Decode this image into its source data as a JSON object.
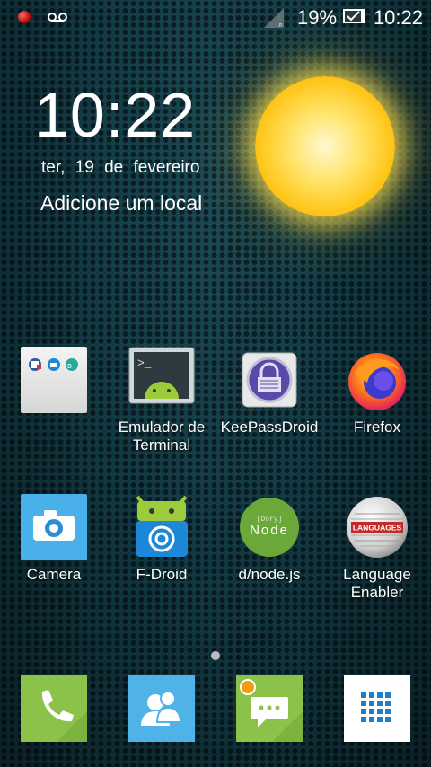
{
  "status_bar": {
    "battery": "19%",
    "time": "10:22"
  },
  "widget": {
    "time": "10:22",
    "date": "ter,  19 de fevereiro",
    "location": "Adicione um local",
    "weather_icon": "sun-icon"
  },
  "apps": [
    {
      "label": "",
      "icon": "folder-icon"
    },
    {
      "label": "Emulador de Terminal",
      "icon": "terminal-icon"
    },
    {
      "label": "KeePassDroid",
      "icon": "keepass-icon"
    },
    {
      "label": "Firefox",
      "icon": "firefox-icon"
    },
    {
      "label": "Camera",
      "icon": "camera-icon"
    },
    {
      "label": "F-Droid",
      "icon": "fdroid-icon"
    },
    {
      "label": "d/node.js",
      "icon": "node-icon"
    },
    {
      "label": "Language Enabler",
      "icon": "language-icon"
    }
  ],
  "node_icon_text": {
    "top": "[Dory]",
    "main": "Node"
  },
  "language_icon_text": "LANGUAGES",
  "dock": [
    {
      "icon": "phone-icon"
    },
    {
      "icon": "contacts-icon"
    },
    {
      "icon": "messages-icon"
    },
    {
      "icon": "app-drawer-icon"
    }
  ],
  "colors": {
    "dock_green": "#8bc34a",
    "dock_blue": "#4fb3e8",
    "camera_blue": "#4ab0ea",
    "fdroid_green": "#9ccc3b"
  }
}
